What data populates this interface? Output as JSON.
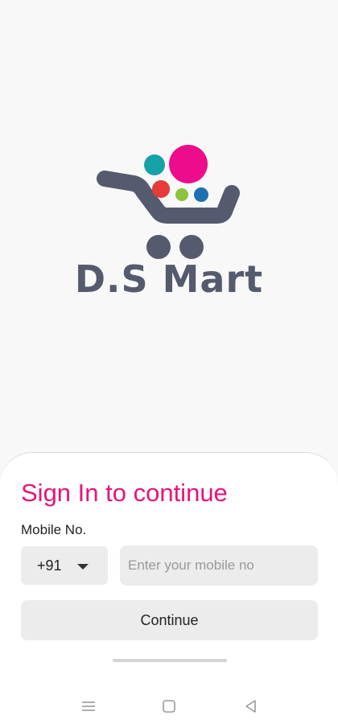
{
  "brand": {
    "name": "D.S Mart",
    "colors": {
      "cart": "#555a6e",
      "magenta": "#ec0c8c",
      "teal": "#17a2a8",
      "red": "#e63b3b",
      "green": "#8cc43c",
      "blue": "#1f6fb3"
    }
  },
  "signin": {
    "title": "Sign In to continue",
    "mobile_label": "Mobile No.",
    "country_code": "+91",
    "mobile_placeholder": "Enter your mobile no",
    "continue_label": "Continue",
    "accent_color": "#e6147a"
  },
  "navbar": {
    "icons": [
      "menu-icon",
      "home-square-icon",
      "back-triangle-icon"
    ]
  }
}
